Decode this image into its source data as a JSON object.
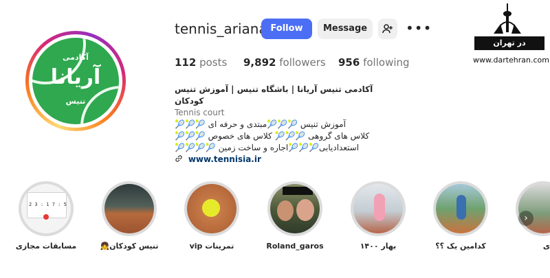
{
  "profile": {
    "avatar_text": {
      "top": "آکادمی",
      "main": "آریانا",
      "bottom": "تنیس"
    },
    "username": "tennis_ariana",
    "follow_label": "Follow",
    "message_label": "Message",
    "more_icon": "more-horizontal-icon",
    "add_user_icon": "person-add-icon"
  },
  "stats": {
    "posts_count": "112",
    "posts_label": "posts",
    "followers_count": "9,892",
    "followers_label": "followers",
    "following_count": "956",
    "following_label": "following"
  },
  "bio": {
    "name": "آکادمی تنیس آریانا | باشگاه تنیس | آموزش تنیس کودکان",
    "category": "Tennis court",
    "line1": "آموزش تنیس 🎾🎾🎾مبتدی و حرفه ای 🎾🎾🎾",
    "line2": "کلاس های گروهی 🎾🎾🎾 کلاس های خصوص 🎾🎾🎾",
    "line3": "استعدادیابی🎾🎾🎾اجاره و ساخت زمین 🎾🎾🎾🎾",
    "link": "www.tennisia.ir",
    "link_icon": "link-icon"
  },
  "watermark": {
    "bar_text": "در تهران",
    "url": "www.dartehran.com"
  },
  "highlights": [
    {
      "label": "مسابقات مجازی",
      "card_digits": "2 3 : 1 7 : 5"
    },
    {
      "label": "تنیس کودکان👧"
    },
    {
      "label": "تمرینات vip"
    },
    {
      "label": "Roland_garos"
    },
    {
      "label": "بهار ۱۴۰۰"
    },
    {
      "label": "کدامین یک ؟؟"
    },
    {
      "label": "ی"
    }
  ],
  "colors": {
    "follow_button": "#4c6ef5",
    "link": "#00376b",
    "avatar_green": "#2fa84f"
  }
}
